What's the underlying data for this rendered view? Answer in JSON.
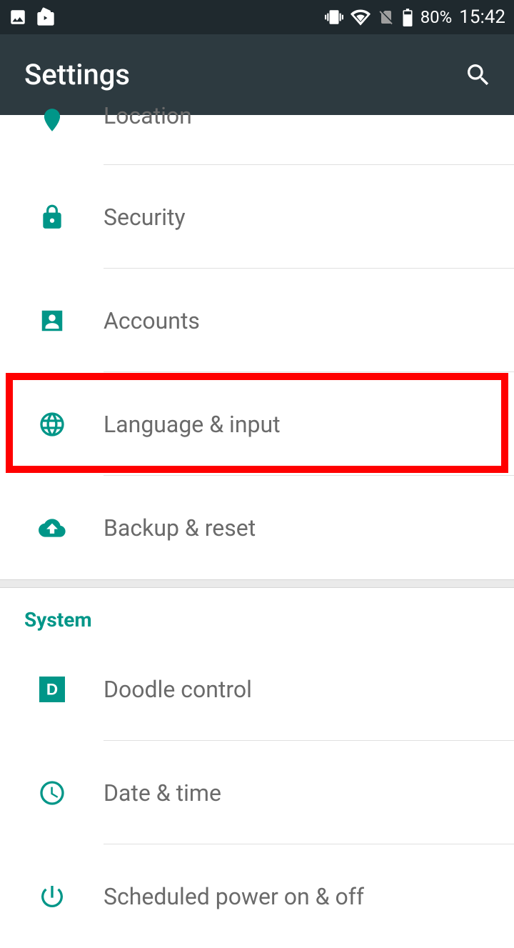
{
  "status": {
    "battery_pct": "80%",
    "time": "15:42"
  },
  "app": {
    "title": "Settings"
  },
  "items": {
    "location": "Location",
    "security": "Security",
    "accounts": "Accounts",
    "language": "Language & input",
    "backup": "Backup & reset",
    "doodle": "Doodle control",
    "datetime": "Date & time",
    "scheduled": "Scheduled power on & off"
  },
  "section": {
    "system": "System"
  },
  "highlight": {
    "target": "language"
  }
}
